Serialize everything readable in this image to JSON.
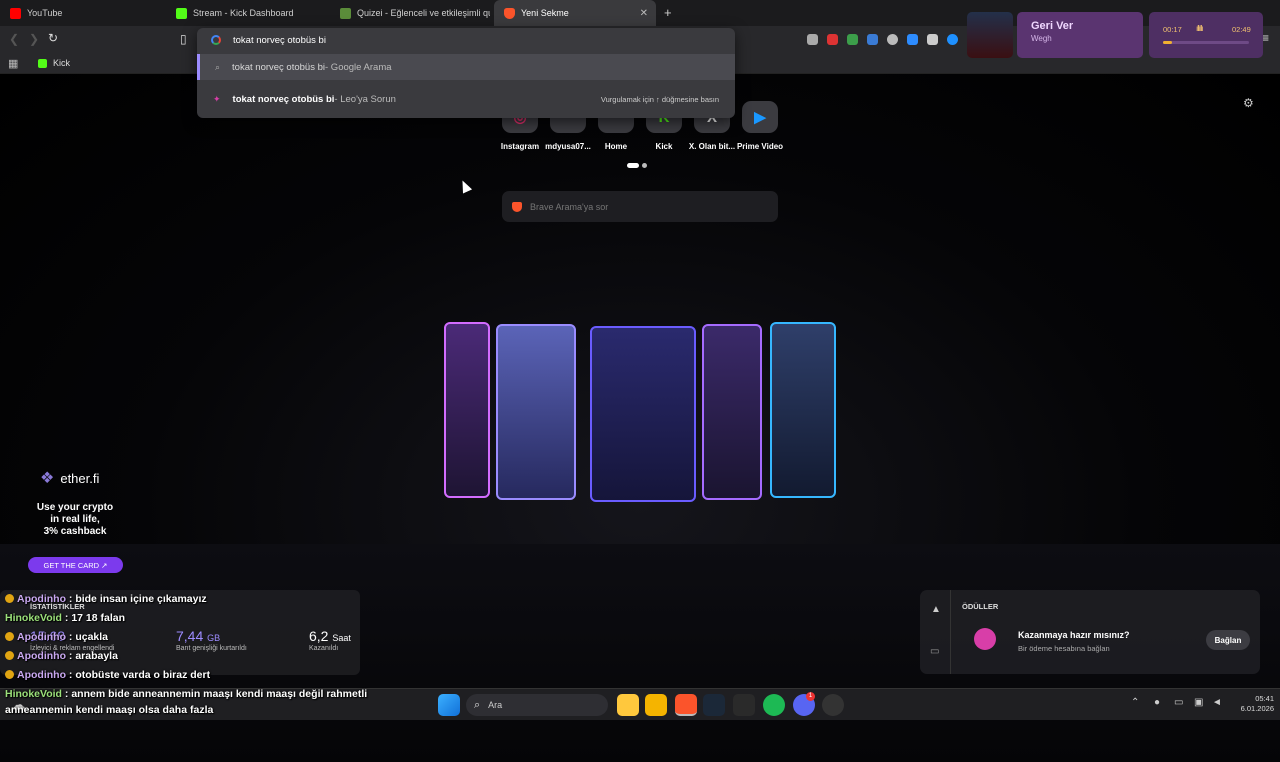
{
  "tabs": [
    {
      "label": "YouTube",
      "icon": "youtube-icon",
      "color": "#ff0000"
    },
    {
      "label": "Stream - Kick Dashboard",
      "icon": "kick-icon",
      "color": "#53fc18"
    },
    {
      "label": "Quizei - Eğlenceli ve etkileşimli quizl",
      "icon": "quiz-icon",
      "color": "#5b8c3a"
    },
    {
      "label": "Yeni Sekme",
      "icon": "brave-icon",
      "color": "#fb542b"
    }
  ],
  "new_tab_symbol": "+",
  "close_symbol": "✕",
  "address": {
    "value": "tokat norveç otobüs bi"
  },
  "suggestions": [
    {
      "query": "tokat norveç otobüs bi",
      "source": " - Google Arama",
      "hint": ""
    },
    {
      "query": "tokat norveç otobüs bi",
      "source": " - Leo'ya Sorun",
      "hint": "Vurgulamak için ↑ düğmesine basın"
    }
  ],
  "bookmarks": [
    {
      "label": "Kick"
    }
  ],
  "media": {
    "cover_title": "Geri Ver",
    "artist": "Wegh",
    "elapsed": "00:17",
    "total": "02:49",
    "progress": 0.1
  },
  "topsites": [
    {
      "label": "Instagram",
      "glyph": "◎",
      "color": "#e1306c"
    },
    {
      "label": "mdyusa07...",
      "glyph": "",
      "color": "#6b6b70"
    },
    {
      "label": "Home",
      "glyph": "▀",
      "color": "#6a7fe0"
    },
    {
      "label": "Kick",
      "glyph": "K",
      "color": "#53fc18"
    },
    {
      "label": "X. Olan bit...",
      "glyph": "X",
      "color": "#ffffff"
    },
    {
      "label": "Prime Video",
      "glyph": "▶",
      "color": "#1a98ff"
    }
  ],
  "search": {
    "placeholder": "Brave Arama'ya sor"
  },
  "sponsor": {
    "brand": "ether.fi",
    "line1": "Use your crypto",
    "line2": "in real life,",
    "line3": "3% cashback",
    "cta": "GET THE CARD ↗"
  },
  "stats": {
    "title": "İSTATİSTİKLER",
    "blocked_value": "15.68",
    "blocked_label": "İzleyici & reklam engellendi",
    "bandwidth_value": "7,44",
    "bandwidth_unit": "GB",
    "bandwidth_label": "Bant genişliği kurtarıldı",
    "time_value": "6,2",
    "time_unit": "Saat",
    "time_label": "Kazanıldı"
  },
  "rewards": {
    "title": "ÖDÜLLER",
    "headline": "Kazanmaya hazır mısınız?",
    "sub": "Bir ödeme hesabına bağlan",
    "button": "Bağlan"
  },
  "chat": [
    {
      "user": "Apodinho",
      "msg": " : bide insan içine çıkamayız",
      "badge": true,
      "color": "purple"
    },
    {
      "user": "HinokeVoid",
      "msg": " : 17 18 falan",
      "badge": false,
      "color": "green"
    },
    {
      "user": "Apodinho",
      "msg": " : uçakla",
      "badge": true,
      "color": "purple"
    },
    {
      "user": "Apodinho",
      "msg": " : arabayla",
      "badge": true,
      "color": "purple"
    },
    {
      "user": "Apodinho",
      "msg": " : otobüste varda o biraz dert",
      "badge": true,
      "color": "purple"
    },
    {
      "user": "HinokeVoid",
      "msg": " : annem bide anneannemin maaşı kendi maaşı değil rahmetli",
      "badge": false,
      "color": "green"
    },
    {
      "user": "",
      "msg": "anneannemin kendi maaşı olsa daha fazla",
      "badge": false,
      "color": "green"
    }
  ],
  "taskbar": {
    "search_label": "Ara",
    "time": "05:41",
    "date": "6.01.2026",
    "notification_count": "1"
  },
  "accent": "#7c3aed"
}
